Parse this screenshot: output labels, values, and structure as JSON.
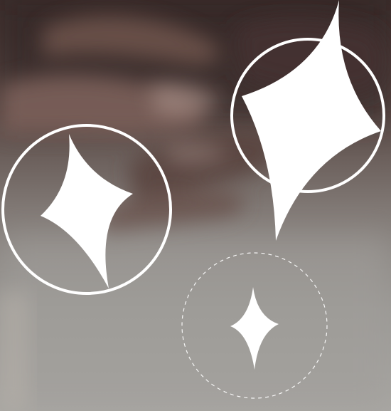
{
  "scene": {
    "description_icon": "sparkle-icon",
    "colors": {
      "sparkle": "#ffffff",
      "ring": "#ffffff",
      "background_top": "#3a2c2a",
      "background_mid": "#6e625d",
      "background_bottom": "#a6a4a0"
    }
  }
}
